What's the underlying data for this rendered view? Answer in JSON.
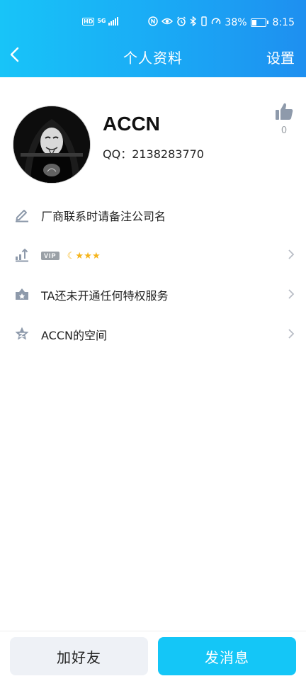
{
  "status_bar": {
    "hd_label": "HD",
    "network_label": "5G",
    "battery_text": "38%",
    "time": "8:15"
  },
  "nav": {
    "title": "个人资料",
    "settings_label": "设置"
  },
  "profile": {
    "username": "ACCN",
    "qq_id": "QQ：2138283770",
    "like_count": "0"
  },
  "rows": [
    {
      "icon": "pencil-icon",
      "text": "厂商联系时请备注公司名"
    },
    {
      "icon": "level-up-icon",
      "vip_label": "VIP",
      "level_icons": [
        "moon",
        "star",
        "star",
        "star"
      ]
    },
    {
      "icon": "privilege-icon",
      "text": "TA还未开通任何特权服务"
    },
    {
      "icon": "qzone-star-icon",
      "text": "ACCN的空间"
    }
  ],
  "buttons": {
    "add_friend": "加好友",
    "send_message": "发消息"
  },
  "colors": {
    "header_gradient_start": "#18c4f8",
    "header_gradient_end": "#1e8ff0",
    "primary_button": "#14c6f7",
    "secondary_button": "#eef1f6",
    "icon_gray": "#8e9aab",
    "level_gold": "#f5b51d"
  }
}
